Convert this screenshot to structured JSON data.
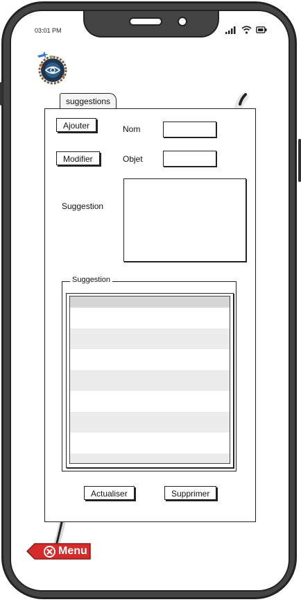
{
  "status_bar": {
    "time": "03:01 PM"
  },
  "icons": {
    "logo": "plane-globe-logo",
    "signal": "signal-icon",
    "wifi": "wifi-icon",
    "battery": "battery-icon",
    "menu_close": "close-circle-icon"
  },
  "tab": {
    "label": "suggestions"
  },
  "form": {
    "add_label": "Ajouter",
    "edit_label": "Modifier",
    "name_label": "Nom",
    "name_value": "",
    "object_label": "Objet",
    "object_value": "",
    "suggestion_label": "Suggestion",
    "suggestion_value": ""
  },
  "list": {
    "title": "Suggestion",
    "rows": [
      "",
      "",
      "",
      "",
      "",
      "",
      "",
      "",
      "",
      "",
      "",
      "",
      "",
      "",
      ""
    ]
  },
  "actions": {
    "refresh_label": "Actualiser",
    "delete_label": "Supprimer"
  },
  "menu": {
    "label": "Menu",
    "color": "#d62b2b"
  },
  "colors": {
    "ink": "#222222",
    "table_header": "#d6d6d6",
    "table_alt": "#ececec"
  }
}
